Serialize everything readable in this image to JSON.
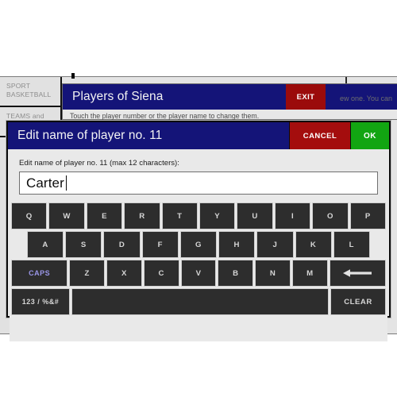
{
  "background": {
    "sidebar": [
      {
        "line1": "SPORT",
        "line2": "BASKETBALL"
      },
      {
        "line1": "TEAMS and",
        "line2": ""
      }
    ],
    "panel": {
      "title": "Players of Siena",
      "exit_label": "EXIT",
      "hint": "Touch the player number or the player name to change them.",
      "right_text": "ew one. You can"
    }
  },
  "dialog": {
    "title": "Edit name of player no. 11",
    "cancel_label": "CANCEL",
    "ok_label": "OK",
    "field_label": "Edit name of player no. 11 (max 12 characters):",
    "field_value": "Carter",
    "field_placeholder": ""
  },
  "keyboard": {
    "row1": [
      "Q",
      "W",
      "E",
      "R",
      "T",
      "Y",
      "U",
      "I",
      "O",
      "P"
    ],
    "row2": [
      "A",
      "S",
      "D",
      "F",
      "G",
      "H",
      "J",
      "K",
      "L"
    ],
    "caps_label": "CAPS",
    "row3": [
      "Z",
      "X",
      "C",
      "V",
      "B",
      "N",
      "M"
    ],
    "backspace_icon": "arrow-left-icon",
    "num_label": "123 / %&#",
    "space_label": "",
    "clear_label": "CLEAR"
  },
  "colors": {
    "title_blue": "#141478",
    "cancel_red": "#a40d0d",
    "ok_green": "#12a512",
    "exit_red": "#9b0b0b",
    "key_dark": "#2d2d2d",
    "caps_text": "#9a96e8",
    "dialog_bg": "#e9e9e9"
  }
}
